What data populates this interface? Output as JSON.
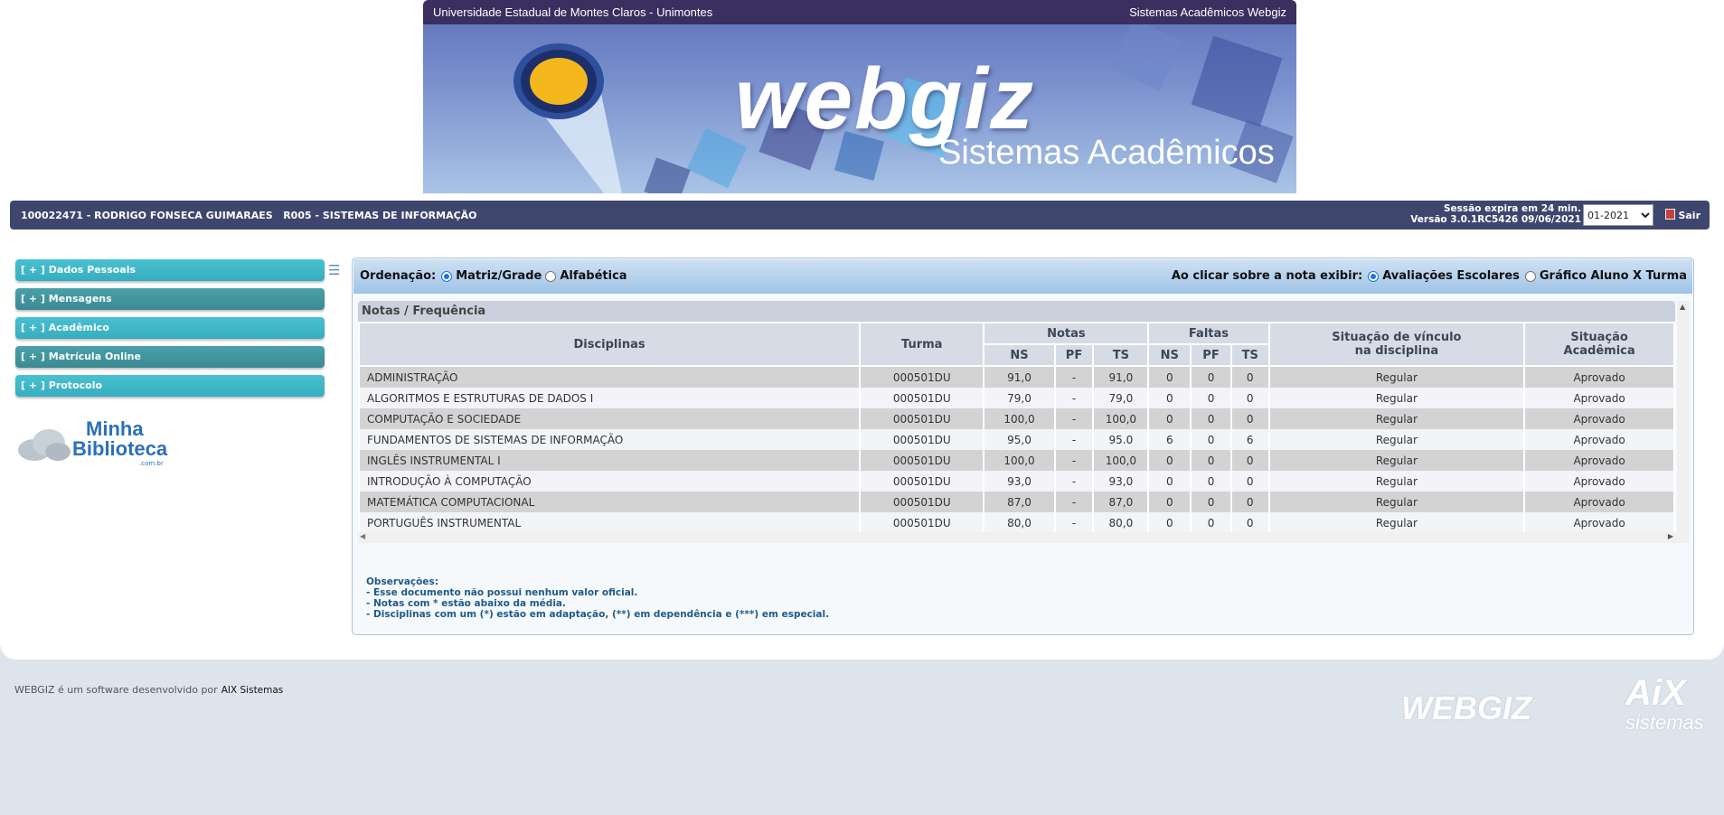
{
  "banner": {
    "university": "Universidade Estadual de Montes Claros - Unimontes",
    "system": "Sistemas Acadêmicos Webgiz",
    "logo_text": "webgiz",
    "logo_subtitle": "Sistemas Acadêmicos"
  },
  "userbar": {
    "student": "100022471 - RODRIGO FONSECA GUIMARAES",
    "course": "R005 - SISTEMAS DE INFORMAÇÃO",
    "session": "Sessão expira em 24 min.",
    "version": "Versão 3.0.1RC5426 09/06/2021",
    "term": "01-2021",
    "logout": "Sair"
  },
  "sidebar": {
    "items": [
      {
        "label": "[ + ] Dados Pessoais"
      },
      {
        "label": "[ + ] Mensagens"
      },
      {
        "label": "[ + ] Acadêmico"
      },
      {
        "label": "[ + ] Matrícula Online"
      },
      {
        "label": "[ + ] Protocolo"
      }
    ],
    "library_line1": "Minha",
    "library_line2": "Biblioteca",
    "library_domain": ".com.br"
  },
  "ordering": {
    "label": "Ordenação:",
    "option1": "Matriz/Grade",
    "option2": "Alfabética",
    "selected": "Matriz/Grade",
    "click_label": "Ao clicar sobre a nota exibir:",
    "click_option1": "Avaliações Escolares",
    "click_option2": "Gráfico Aluno X Turma"
  },
  "grid": {
    "caption": "Notas / Frequência",
    "headers": {
      "disciplinas": "Disciplinas",
      "turma": "Turma",
      "notas": "Notas",
      "faltas": "Faltas",
      "situacao_vinculo_l1": "Situação de vínculo",
      "situacao_vinculo_l2": "na disciplina",
      "situacao_academica_l1": "Situação",
      "situacao_academica_l2": "Acadêmica",
      "ns": "NS",
      "pf": "PF",
      "ts": "TS"
    },
    "rows": [
      {
        "disc": "ADMINISTRAÇÃO",
        "turma": "000501DU",
        "n_ns": "91,0",
        "n_pf": "-",
        "n_ts": "91,0",
        "f_ns": "0",
        "f_pf": "0",
        "f_ts": "0",
        "vinculo": "Regular",
        "situacao": "Aprovado"
      },
      {
        "disc": "ALGORITMOS E ESTRUTURAS DE DADOS I",
        "turma": "000501DU",
        "n_ns": "79,0",
        "n_pf": "-",
        "n_ts": "79,0",
        "f_ns": "0",
        "f_pf": "0",
        "f_ts": "0",
        "vinculo": "Regular",
        "situacao": "Aprovado"
      },
      {
        "disc": "COMPUTAÇÃO E SOCIEDADE",
        "turma": "000501DU",
        "n_ns": "100,0",
        "n_pf": "-",
        "n_ts": "100,0",
        "f_ns": "0",
        "f_pf": "0",
        "f_ts": "0",
        "vinculo": "Regular",
        "situacao": "Aprovado"
      },
      {
        "disc": "FUNDAMENTOS DE SISTEMAS DE INFORMAÇÃO",
        "turma": "000501DU",
        "n_ns": "95,0",
        "n_pf": "-",
        "n_ts": "95.0",
        "f_ns": "6",
        "f_pf": "0",
        "f_ts": "6",
        "vinculo": "Regular",
        "situacao": "Aprovado"
      },
      {
        "disc": "INGLÊS INSTRUMENTAL I",
        "turma": "000501DU",
        "n_ns": "100,0",
        "n_pf": "-",
        "n_ts": "100,0",
        "f_ns": "0",
        "f_pf": "0",
        "f_ts": "0",
        "vinculo": "Regular",
        "situacao": "Aprovado"
      },
      {
        "disc": "INTRODUÇÃO À COMPUTAÇÃO",
        "turma": "000501DU",
        "n_ns": "93,0",
        "n_pf": "-",
        "n_ts": "93,0",
        "f_ns": "0",
        "f_pf": "0",
        "f_ts": "0",
        "vinculo": "Regular",
        "situacao": "Aprovado"
      },
      {
        "disc": "MATEMÁTICA COMPUTACIONAL",
        "turma": "000501DU",
        "n_ns": "87,0",
        "n_pf": "-",
        "n_ts": "87,0",
        "f_ns": "0",
        "f_pf": "0",
        "f_ts": "0",
        "vinculo": "Regular",
        "situacao": "Aprovado"
      },
      {
        "disc": "PORTUGUÊS INSTRUMENTAL",
        "turma": "000501DU",
        "n_ns": "80,0",
        "n_pf": "-",
        "n_ts": "80,0",
        "f_ns": "0",
        "f_pf": "0",
        "f_ts": "0",
        "vinculo": "Regular",
        "situacao": "Aprovado"
      }
    ]
  },
  "observations": {
    "title": "Observações:",
    "line1": "- Esse documento não possui nenhum valor oficial.",
    "line2": "- Notas com * estão abaixo da média.",
    "line3": "- Disciplinas com um (*) estão em adaptação, (**) em dependência e (***) em especial."
  },
  "footer": {
    "text": "WEBGIZ é um software desenvolvido por",
    "link": "AIX Sistemas",
    "logo1": "WEBGIZ",
    "logo2": "AiX",
    "logo2_sub": "sistemas"
  },
  "colors": {
    "userbar": "#3f466e",
    "menu_light": "#3fb7c8",
    "menu_dark": "#3f949d",
    "banner_top": "#3a2f5e"
  }
}
